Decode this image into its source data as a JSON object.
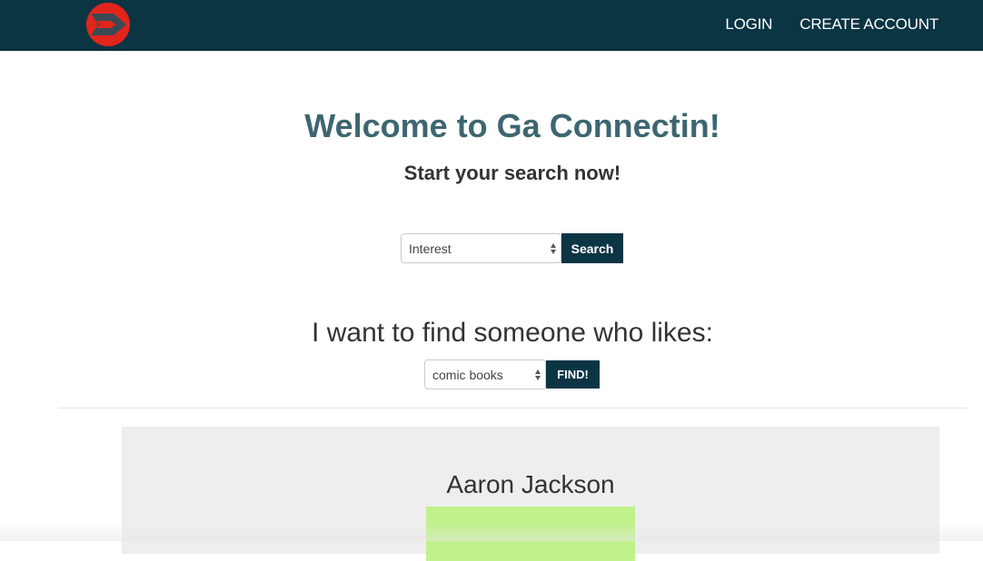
{
  "header": {
    "logo": "logo-icon",
    "nav": {
      "login_label": "LOGIN",
      "create_account_label": "CREATE ACCOUNT"
    }
  },
  "main": {
    "title": "Welcome to Ga Connectin!",
    "subtitle": "Start your search now!",
    "search": {
      "select_value": "Interest",
      "button_label": "Search"
    },
    "find": {
      "heading": "I want to find someone who likes:",
      "select_value": "comic books",
      "button_label": "FIND!"
    }
  },
  "results": [
    {
      "name": "Aaron Jackson",
      "photo_color": "#c1f18b"
    }
  ],
  "colors": {
    "navbar": "#0c3544",
    "accent": "#3d6670",
    "card_bg": "#eeeeee"
  }
}
